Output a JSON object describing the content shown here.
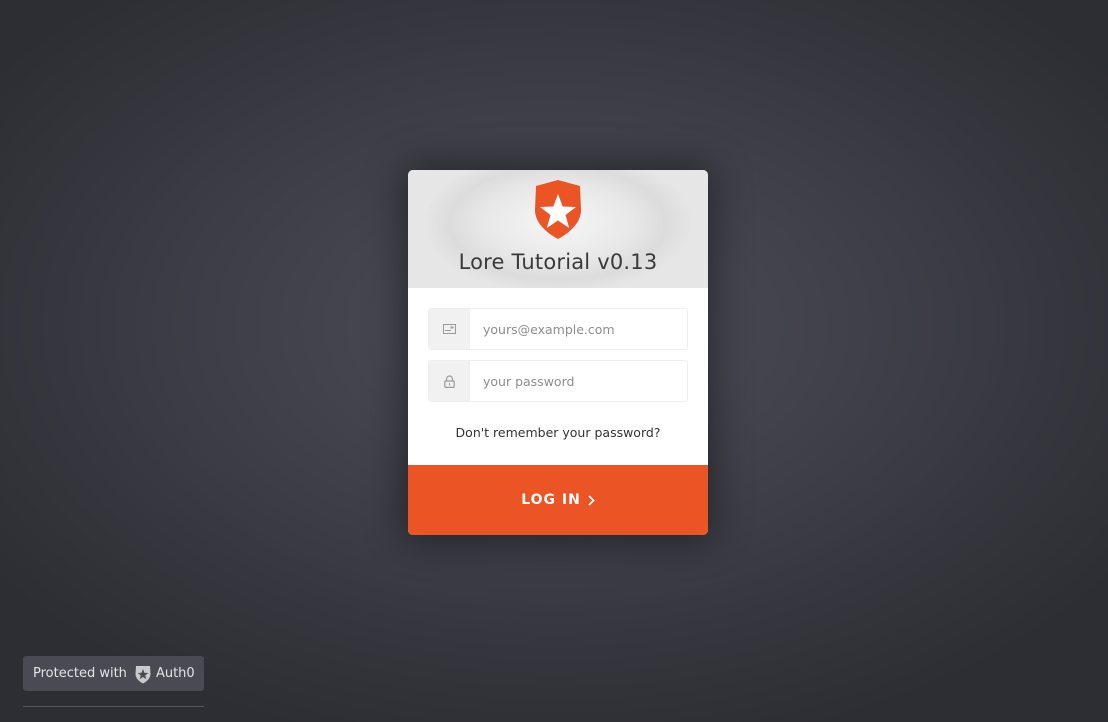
{
  "card": {
    "title": "Lore Tutorial v0.13",
    "logo_icon": "auth0-shield-star-icon"
  },
  "email": {
    "placeholder": "yours@example.com",
    "value": "",
    "icon": "envelope-icon"
  },
  "password": {
    "placeholder": "your password",
    "value": "",
    "icon": "lock-icon"
  },
  "forgot_password_label": "Don't remember your password?",
  "login_button": {
    "label": "LOG IN",
    "icon": "chevron-right-icon"
  },
  "badge": {
    "prefix": "Protected with",
    "brand": "Auth0",
    "icon": "auth0-logo-icon"
  },
  "colors": {
    "accent": "#eb5424",
    "background": "#3f4049",
    "card": "#ffffff"
  }
}
